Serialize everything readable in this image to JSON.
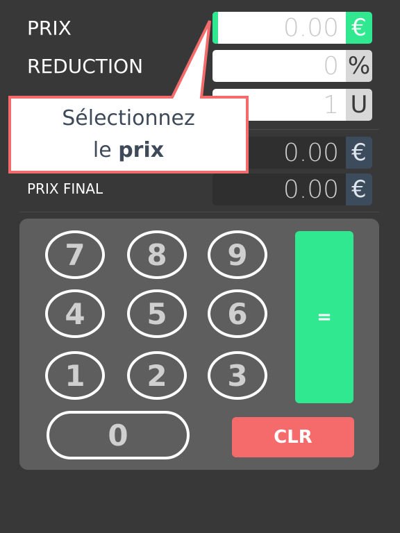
{
  "fields": {
    "prix": {
      "label": "PRIX",
      "value": "0.00",
      "unit": "€"
    },
    "reduction": {
      "label": "REDUCTION",
      "value": "0",
      "unit": "%"
    },
    "quantite": {
      "label": "",
      "value": "1",
      "unit": "U"
    },
    "economie": {
      "label": "",
      "value": "0.00",
      "unit": "€"
    },
    "prix_final": {
      "label": "PRIX FINAL",
      "value": "0.00",
      "unit": "€"
    }
  },
  "keypad": {
    "keys": [
      "7",
      "8",
      "9",
      "4",
      "5",
      "6",
      "1",
      "2",
      "3"
    ],
    "zero": "0",
    "equals": "=",
    "clear": "CLR"
  },
  "tooltip": {
    "line1": "Sélectionnez",
    "line2_prefix": "le ",
    "line2_bold": "prix"
  },
  "colors": {
    "accent": "#2fe88f",
    "clear": "#f56b6b",
    "background": "#383838",
    "keypad_bg": "#5e5e5e",
    "unit_output_bg": "#3d4c5c",
    "tooltip_border": "#f56b6b"
  }
}
